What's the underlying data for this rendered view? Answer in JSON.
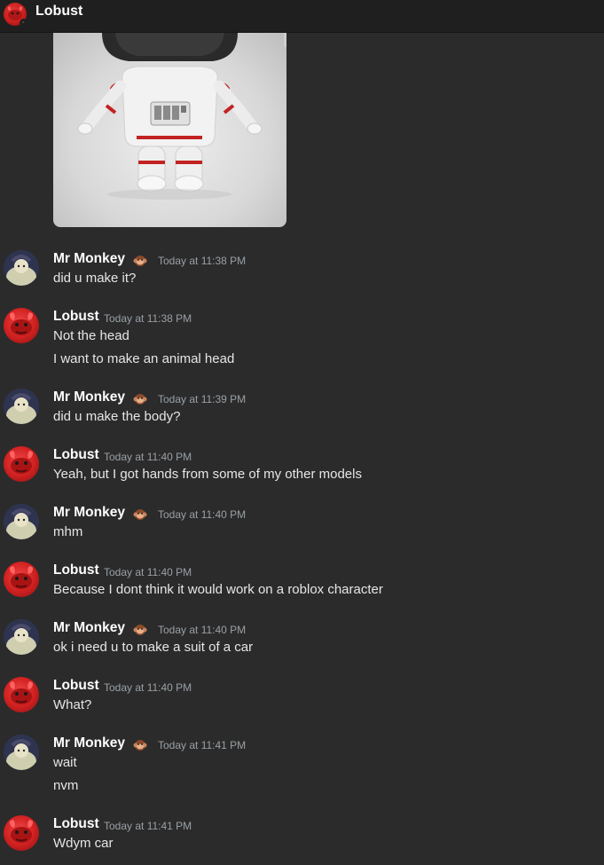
{
  "header": {
    "title": "Lobust",
    "avatar": "red-avatar",
    "status": "offline"
  },
  "attachment": {
    "type": "image",
    "description": "3D astronaut character model seen from behind"
  },
  "messages": [
    {
      "author": "Mr Monkey",
      "badge": "monkey-emoji-icon",
      "time": "Today at 11:38 PM",
      "lines": [
        "did u make it?"
      ]
    },
    {
      "author": "Lobust",
      "time": "Today at 11:38 PM",
      "lines": [
        "Not the head",
        "I want to make an animal head"
      ]
    },
    {
      "author": "Mr Monkey",
      "badge": "monkey-emoji-icon",
      "time": "Today at 11:39 PM",
      "lines": [
        "did u make the body?"
      ]
    },
    {
      "author": "Lobust",
      "time": "Today at 11:40 PM",
      "lines": [
        "Yeah, but I got hands from some of my other models"
      ]
    },
    {
      "author": "Mr Monkey",
      "badge": "monkey-emoji-icon",
      "time": "Today at 11:40 PM",
      "lines": [
        "mhm"
      ]
    },
    {
      "author": "Lobust",
      "time": "Today at 11:40 PM",
      "lines": [
        "Because I dont think it would work on a roblox character"
      ]
    },
    {
      "author": "Mr Monkey",
      "badge": "monkey-emoji-icon",
      "time": "Today at 11:40 PM",
      "lines": [
        "ok i need u to make a suit of a car"
      ]
    },
    {
      "author": "Lobust",
      "time": "Today at 11:40 PM",
      "lines": [
        "What?"
      ]
    },
    {
      "author": "Mr Monkey",
      "badge": "monkey-emoji-icon",
      "time": "Today at 11:41 PM",
      "lines": [
        "wait",
        "nvm"
      ]
    },
    {
      "author": "Lobust",
      "time": "Today at 11:41 PM",
      "lines": [
        "Wdym car"
      ]
    }
  ]
}
